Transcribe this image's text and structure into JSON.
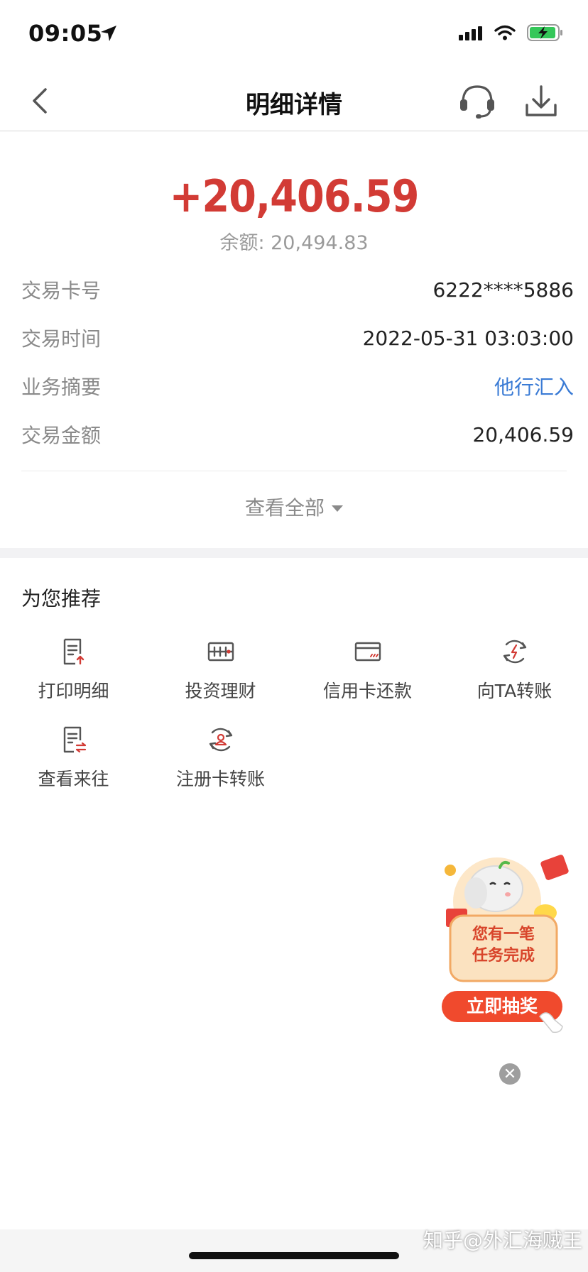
{
  "status_bar": {
    "time": "09:05"
  },
  "header": {
    "title": "明细详情"
  },
  "summary": {
    "amount": "+20,406.59",
    "balance": "余额: 20,494.83"
  },
  "details": [
    {
      "label": "交易卡号",
      "value": "6222****5886"
    },
    {
      "label": "交易时间",
      "value": "2022-05-31 03:03:00"
    },
    {
      "label": "业务摘要",
      "value": "他行汇入"
    },
    {
      "label": "交易金额",
      "value": "20,406.59"
    }
  ],
  "view_all_label": "查看全部",
  "recommend": {
    "title": "为您推荐",
    "items": [
      {
        "label": "打印明细",
        "icon": "print-detail-icon"
      },
      {
        "label": "投资理财",
        "icon": "invest-icon"
      },
      {
        "label": "信用卡还款",
        "icon": "credit-card-icon"
      },
      {
        "label": "向TA转账",
        "icon": "transfer-to-ta-icon"
      },
      {
        "label": "查看来往",
        "icon": "view-exchanges-icon"
      },
      {
        "label": "注册卡转账",
        "icon": "registered-card-transfer-icon"
      }
    ]
  },
  "promo": {
    "line1": "您有一笔",
    "line2": "任务完成",
    "button": "立即抽奖"
  },
  "watermark": "知乎@外汇海贼王",
  "colors": {
    "amount": "#d23b35",
    "link": "#3a7bd5",
    "icon": "#555555",
    "icon_accent": "#d23b35",
    "promo_button": "#f04a2d"
  }
}
